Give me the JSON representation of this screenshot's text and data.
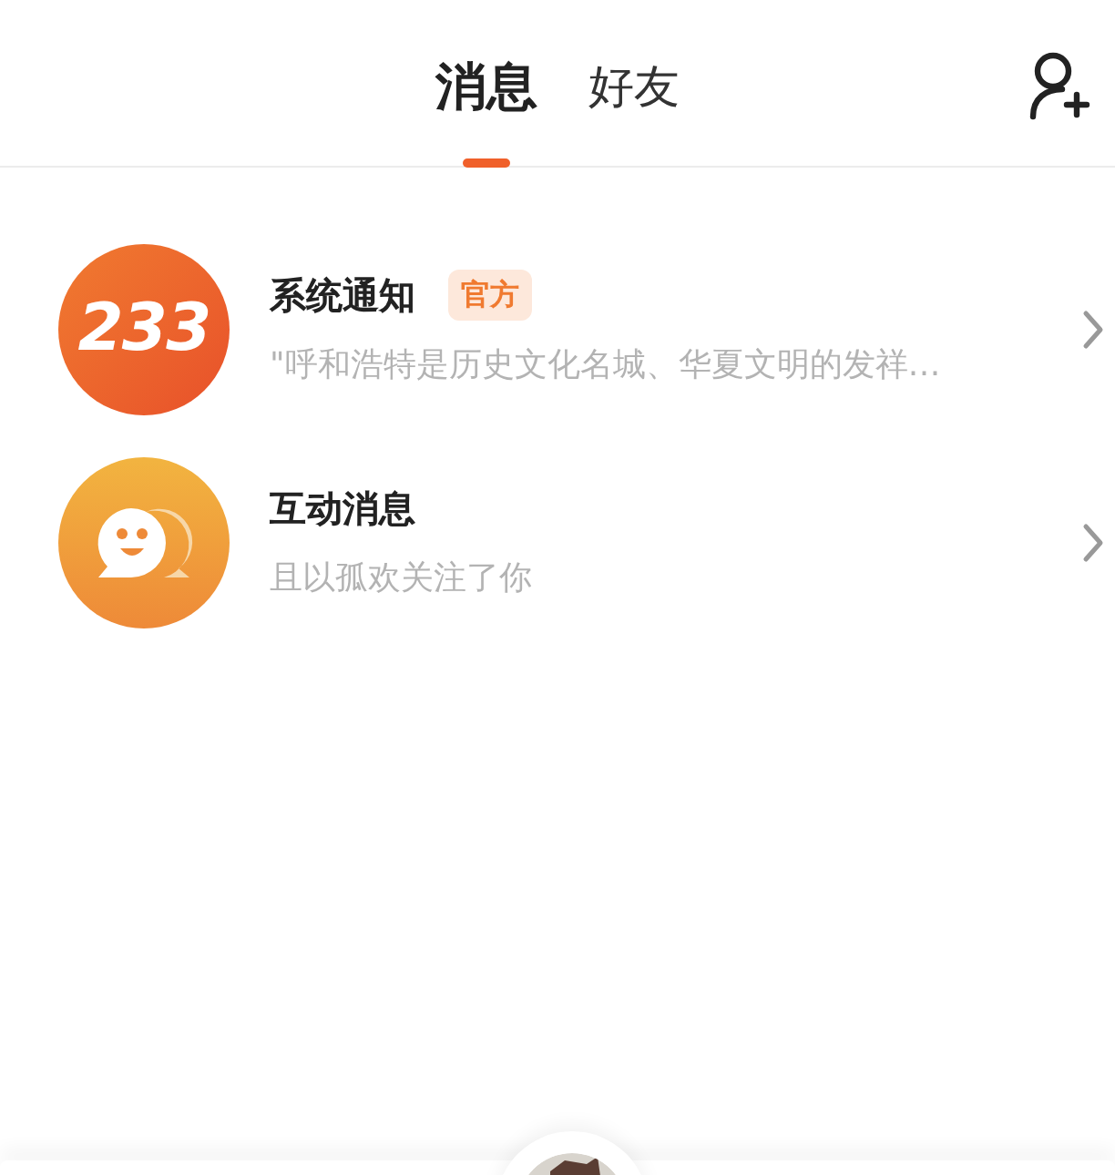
{
  "tabs": [
    {
      "label": "消息",
      "selected": true
    },
    {
      "label": "好友",
      "selected": false
    }
  ],
  "conversations": [
    {
      "kind": "system",
      "logo_text": "233",
      "title": "系统通知",
      "badge": "官方",
      "preview": "\"呼和浩特是历史文化名城、华夏文明的发祥…"
    },
    {
      "kind": "interaction",
      "title": "互动消息",
      "preview": "且以孤欢关注了你"
    }
  ]
}
